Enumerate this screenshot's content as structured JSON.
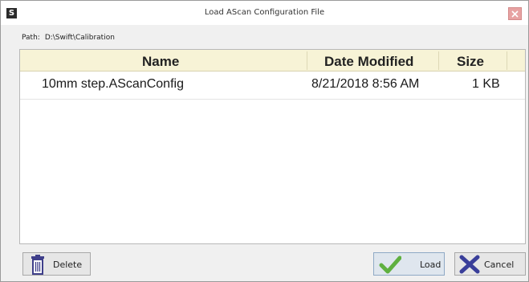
{
  "window": {
    "title": "Load AScan Configuration File",
    "app_icon_glyph": "S"
  },
  "path": {
    "label": "Path:",
    "value": "D:\\Swift\\Calibration"
  },
  "columns": {
    "name": "Name",
    "date_modified": "Date Modified",
    "size": "Size"
  },
  "files": [
    {
      "name": "10mm step.AScanConfig",
      "date_modified": "8/21/2018 8:56 AM",
      "size": "1 KB"
    }
  ],
  "buttons": {
    "delete_label": "Delete",
    "load_label": "Load",
    "cancel_label": "Cancel"
  },
  "icons": {
    "app": "app-icon",
    "close": "close-icon",
    "delete": "trash-icon",
    "load": "checkmark-icon",
    "cancel": "x-mark-icon"
  },
  "colors": {
    "header_bg": "#f7f3d6",
    "checkmark": "#5fb040",
    "cancel_x": "#3a3f9a",
    "trash": "#3f3f8a"
  }
}
